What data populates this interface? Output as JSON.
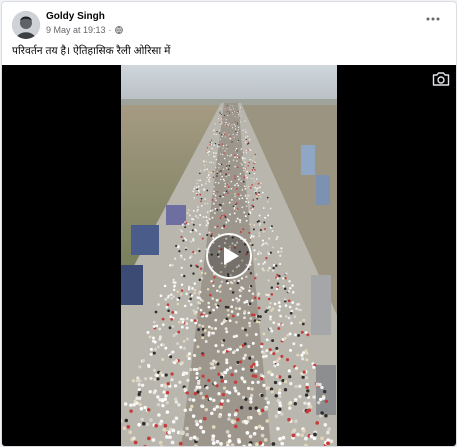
{
  "post": {
    "author": "Goldy Singh",
    "timestamp": "9 May at 19:13",
    "separator": "·",
    "privacy_icon": "globe-icon",
    "caption": "परिवर्तन तय है। ऐतिहासिक रैली  ओरिसा में"
  },
  "icons": {
    "more": "more-options-icon",
    "play": "play-icon",
    "camera": "camera-icon"
  },
  "colors": {
    "card_bg": "#ffffff",
    "page_bg": "#f0f2f5",
    "name_text": "#050505",
    "meta_text": "#65676b",
    "video_bg": "#000000"
  }
}
